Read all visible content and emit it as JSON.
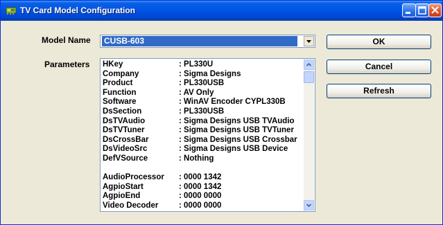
{
  "window": {
    "title": "TV Card Model Configuration",
    "buttons": [
      "minimize",
      "maximize",
      "close"
    ]
  },
  "model": {
    "label": "Model Name",
    "value": "CUSB-603"
  },
  "parameters": {
    "label": "Parameters",
    "rows": [
      {
        "key": "HKey",
        "value": ": PL330U"
      },
      {
        "key": "Company",
        "value": ": Sigma Designs"
      },
      {
        "key": "Product",
        "value": ": PL330USB"
      },
      {
        "key": "Function",
        "value": ": AV Only"
      },
      {
        "key": "Software",
        "value": ": WinAV Encoder CYPL330B"
      },
      {
        "key": "DsSection",
        "value": ": PL330USB"
      },
      {
        "key": "DsTVAudio",
        "value": ": Sigma Designs USB TVAudio"
      },
      {
        "key": "DsTVTuner",
        "value": ": Sigma Designs USB TVTuner"
      },
      {
        "key": "DsCrossBar",
        "value": ": Sigma Designs USB Crossbar"
      },
      {
        "key": "DsVideoSrc",
        "value": ": Sigma Designs USB Device"
      },
      {
        "key": "DefVSource",
        "value": ": Nothing"
      },
      {
        "key": "",
        "value": ""
      },
      {
        "key": "AudioProcessor",
        "value": ": 0000 1342"
      },
      {
        "key": "AgpioStart",
        "value": ": 0000 1342"
      },
      {
        "key": "AgpioEnd",
        "value": ": 0000 0000"
      },
      {
        "key": "Video Decoder",
        "value": ": 0000 0000"
      }
    ]
  },
  "actions": {
    "ok": "OK",
    "cancel": "Cancel",
    "refresh": "Refresh"
  },
  "icons": {
    "app": "tv-card-icon",
    "dropdown": "chevron-down-icon",
    "scroll_up": "arrow-up-icon",
    "scroll_down": "arrow-down-icon"
  }
}
